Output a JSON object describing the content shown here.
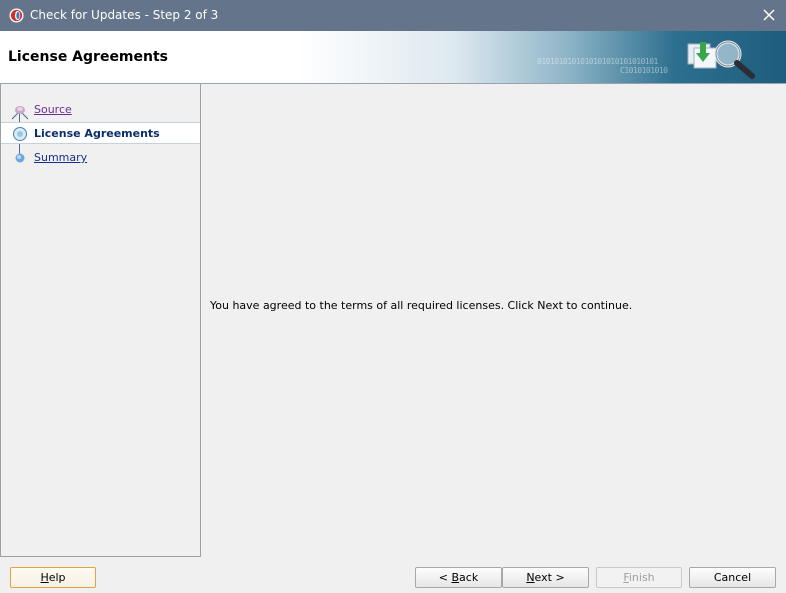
{
  "window": {
    "title": "Check for Updates - Step 2 of 3"
  },
  "banner": {
    "heading": "License Agreements",
    "binary_text": "0101010101010101010101010101",
    "binary_text_2": "C1010101010"
  },
  "steps": [
    {
      "label": "Source",
      "state": "visited"
    },
    {
      "label": "License Agreements",
      "state": "current"
    },
    {
      "label": "Summary",
      "state": "future"
    }
  ],
  "content": {
    "message": "You have agreed to the terms of all required licenses. Click Next to continue."
  },
  "buttons": {
    "help": {
      "mnemonic": "H",
      "rest": "elp"
    },
    "back": {
      "prefix": "< ",
      "mnemonic": "B",
      "rest": "ack"
    },
    "next": {
      "mnemonic": "N",
      "rest": "ext >"
    },
    "finish": {
      "mnemonic": "F",
      "rest": "inish",
      "enabled": false
    },
    "cancel": {
      "label": "Cancel"
    }
  },
  "colors": {
    "titlebar": "#64748a",
    "visited_link": "#6a2f8c",
    "current_step": "#0c2d6b",
    "future_link": "#1a2f8a",
    "help_border": "#e4a13f"
  }
}
